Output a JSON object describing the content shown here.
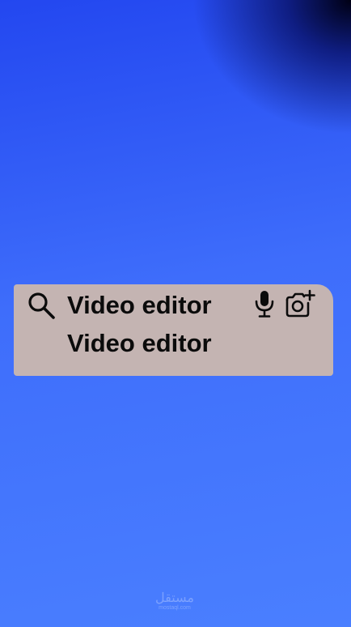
{
  "search": {
    "query": "Video editor",
    "suggestion": "Video editor",
    "icons": {
      "search": "search-icon",
      "mic": "microphone-icon",
      "camera": "camera-add-icon"
    },
    "background_color": "#c4b4b2"
  },
  "watermark": {
    "logo_text": "مستقل",
    "url": "mostaql.com"
  },
  "colors": {
    "background_top": "#2347f0",
    "background_bottom": "#4a7fff",
    "corner_shadow": "#000014",
    "text": "#0b0b0b"
  }
}
